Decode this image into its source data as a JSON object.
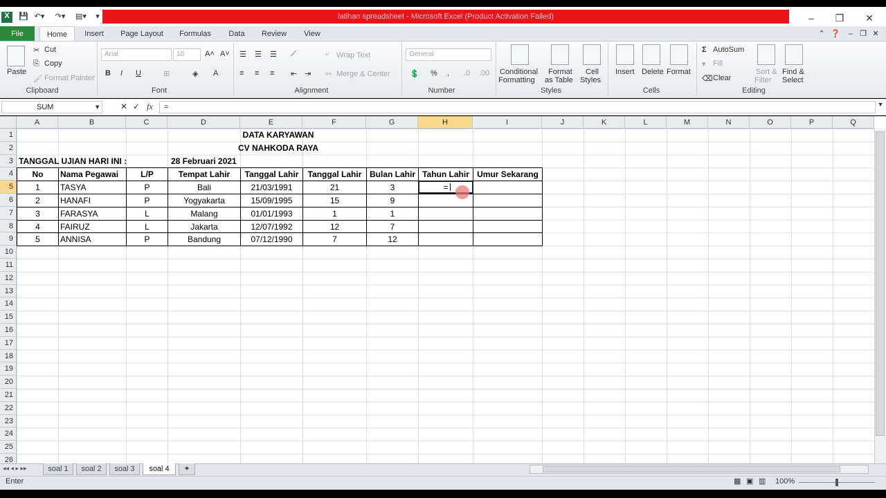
{
  "window": {
    "title": "latihan spreadsheet - Microsoft Excel (Product Activation Failed)",
    "controls": [
      "–",
      "❐",
      "✕"
    ]
  },
  "ribbon_tabs": [
    "File",
    "Home",
    "Insert",
    "Page Layout",
    "Formulas",
    "Data",
    "Review",
    "View"
  ],
  "clipboard": {
    "paste": "Paste",
    "cut": "Cut",
    "copy": "Copy",
    "format_painter": "Format Painter",
    "label": "Clipboard"
  },
  "font": {
    "name": "Arial",
    "size": "10",
    "label": "Font"
  },
  "alignment": {
    "wrap": "Wrap Text",
    "merge": "Merge & Center",
    "label": "Alignment"
  },
  "number": {
    "format": "General",
    "label": "Number"
  },
  "styles": {
    "conditional": "Conditional",
    "conditional2": "Formatting",
    "format_table": "Format",
    "format_table2": "as Table",
    "cell_styles": "Cell",
    "cell_styles2": "Styles",
    "label": "Styles"
  },
  "cells": {
    "insert": "Insert",
    "delete": "Delete",
    "format": "Format",
    "label": "Cells"
  },
  "editing": {
    "autosum": "AutoSum",
    "fill": "Fill",
    "clear": "Clear",
    "sort": "Sort &",
    "sort2": "Filter",
    "find": "Find &",
    "find2": "Select",
    "label": "Editing"
  },
  "formula_bar": {
    "name_box": "SUM",
    "formula": "="
  },
  "columns": [
    "A",
    "B",
    "C",
    "D",
    "E",
    "F",
    "G",
    "H",
    "I",
    "J",
    "K",
    "L",
    "M",
    "N",
    "O",
    "P",
    "Q"
  ],
  "rows": [
    "1",
    "2",
    "3",
    "4",
    "5",
    "6",
    "7",
    "8",
    "9",
    "10",
    "11",
    "12",
    "13",
    "14",
    "15",
    "16",
    "17",
    "18",
    "19",
    "20",
    "21",
    "22",
    "23",
    "24",
    "25",
    "26"
  ],
  "sheet": {
    "title1": "DATA KARYAWAN",
    "title2": "CV NAHKODA RAYA",
    "date_label": "TANGGAL UJIAN HARI INI :",
    "date_value": "28 Februari 2021",
    "headers": [
      "No",
      "Nama Pegawai",
      "L/P",
      "Tempat Lahir",
      "Tanggal Lahir",
      "Tanggal Lahir",
      "Bulan Lahir",
      "Tahun Lahir",
      "Umur Sekarang"
    ],
    "records": [
      [
        "1",
        "TASYA",
        "P",
        "Bali",
        "21/03/1991",
        "21",
        "3",
        "="
      ],
      [
        "2",
        "HANAFI",
        "P",
        "Yogyakarta",
        "15/09/1995",
        "15",
        "9",
        ""
      ],
      [
        "3",
        "FARASYA",
        "L",
        "Malang",
        "01/01/1993",
        "1",
        "1",
        ""
      ],
      [
        "4",
        "FAIRUZ",
        "L",
        "Jakarta",
        "12/07/1992",
        "12",
        "7",
        ""
      ],
      [
        "5",
        "ANNISA",
        "P",
        "Bandung",
        "07/12/1990",
        "7",
        "12",
        ""
      ]
    ]
  },
  "sheet_tabs": [
    "soal 1",
    "soal 2",
    "soal 3",
    "soal 4"
  ],
  "status": {
    "mode": "Enter",
    "zoom": "100%"
  }
}
